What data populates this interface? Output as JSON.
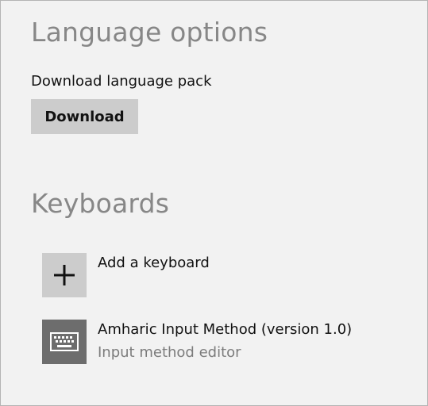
{
  "language_options": {
    "title": "Language options",
    "download_label": "Download language pack",
    "download_button": "Download"
  },
  "keyboards": {
    "title": "Keyboards",
    "add_label": "Add a keyboard",
    "add_icon": "plus-icon",
    "items": [
      {
        "name": "Amharic Input Method (version 1.0)",
        "description": "Input method editor",
        "icon": "keyboard-icon"
      }
    ]
  },
  "colors": {
    "background": "#f2f2f2",
    "section_title": "#878787",
    "button_bg": "#cccccc",
    "keyboard_tile": "#6d6d6d",
    "secondary_text": "#7c7c7c"
  }
}
